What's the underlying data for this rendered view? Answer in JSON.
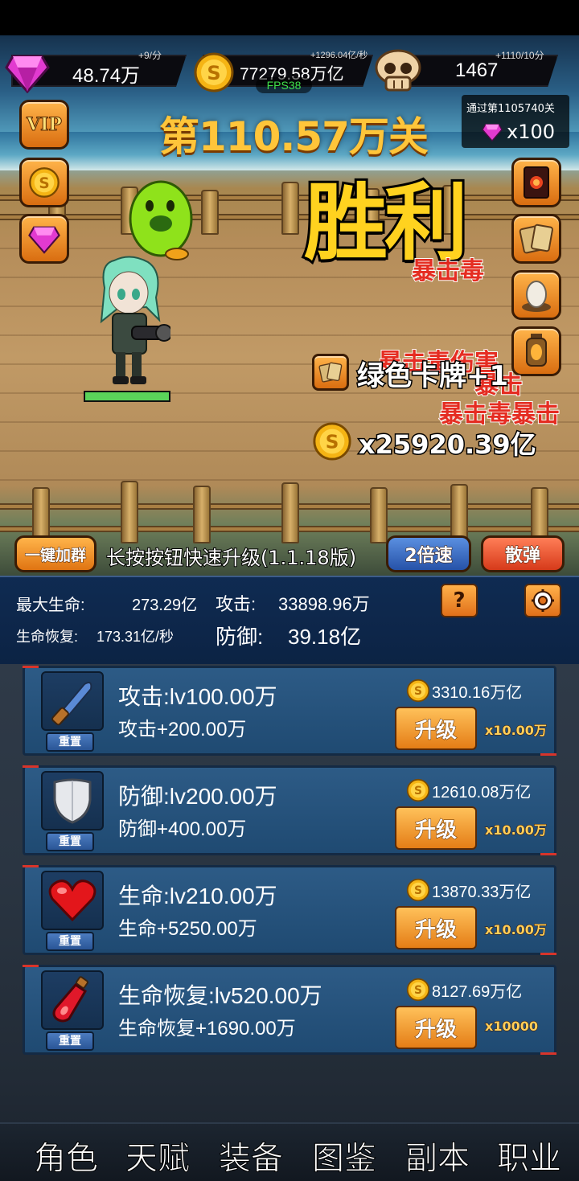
{
  "resources": {
    "gems": {
      "value": "48.74万",
      "rate": "+9/分"
    },
    "gold": {
      "value": "77279.58万亿",
      "rate": "+1296.04亿/秒"
    },
    "skull": {
      "value": "1467",
      "rate": "+1110/10分"
    }
  },
  "fps": "FPS38",
  "stage_title": "第110.57万关",
  "reward": {
    "label": "通过第1105740关",
    "count": "x100"
  },
  "victory_text": "胜利",
  "floating": {
    "card_loot": "绿色卡牌+1",
    "gold_loot": "x25920.39亿",
    "crit_labels": [
      "暴击毒",
      "暴击毒暴击",
      "暴击毒伤害",
      "暴击"
    ]
  },
  "side_left": [
    "VIP",
    "gold",
    "gem"
  ],
  "side_right": [
    "card-deck",
    "cards",
    "egg",
    "lantern"
  ],
  "player_hp_fraction": 1.0,
  "action_bar": {
    "join_group": "一键加群",
    "hint": "长按按钮快速升级(1.1.18版)",
    "speed": "2倍速",
    "scatter": "散弹"
  },
  "stats": {
    "max_hp_label": "最大生命:",
    "max_hp_value": "273.29亿",
    "attack_label": "攻击:",
    "attack_value": "33898.96万",
    "regen_label": "生命恢复:",
    "regen_value": "173.31亿/秒",
    "defense_label": "防御:",
    "defense_value": "39.18亿",
    "help_label": "?"
  },
  "upgrades": [
    {
      "icon": "knife-icon",
      "title": "攻击:lv100.00万",
      "desc": "攻击+200.00万",
      "cost": "3310.16万亿",
      "button": "升级",
      "mult": "x10.00万",
      "reset": "重置"
    },
    {
      "icon": "shield-icon",
      "title": "防御:lv200.00万",
      "desc": "防御+400.00万",
      "cost": "12610.08万亿",
      "button": "升级",
      "mult": "x10.00万",
      "reset": "重置"
    },
    {
      "icon": "heart-icon",
      "title": "生命:lv210.00万",
      "desc": "生命+5250.00万",
      "cost": "13870.33万亿",
      "button": "升级",
      "mult": "x10.00万",
      "reset": "重置"
    },
    {
      "icon": "potion-icon",
      "title": "生命恢复:lv520.00万",
      "desc": "生命恢复+1690.00万",
      "cost": "8127.69万亿",
      "button": "升级",
      "mult": "x10000",
      "reset": "重置"
    }
  ],
  "tabs": [
    "角色",
    "天赋",
    "装备",
    "图鉴",
    "副本",
    "职业"
  ],
  "colors": {
    "gold": "#ffc53a",
    "victory": "#ffd21f",
    "panel": "#0f2b52",
    "card": "#2d5b86",
    "button": "#e47d16"
  }
}
